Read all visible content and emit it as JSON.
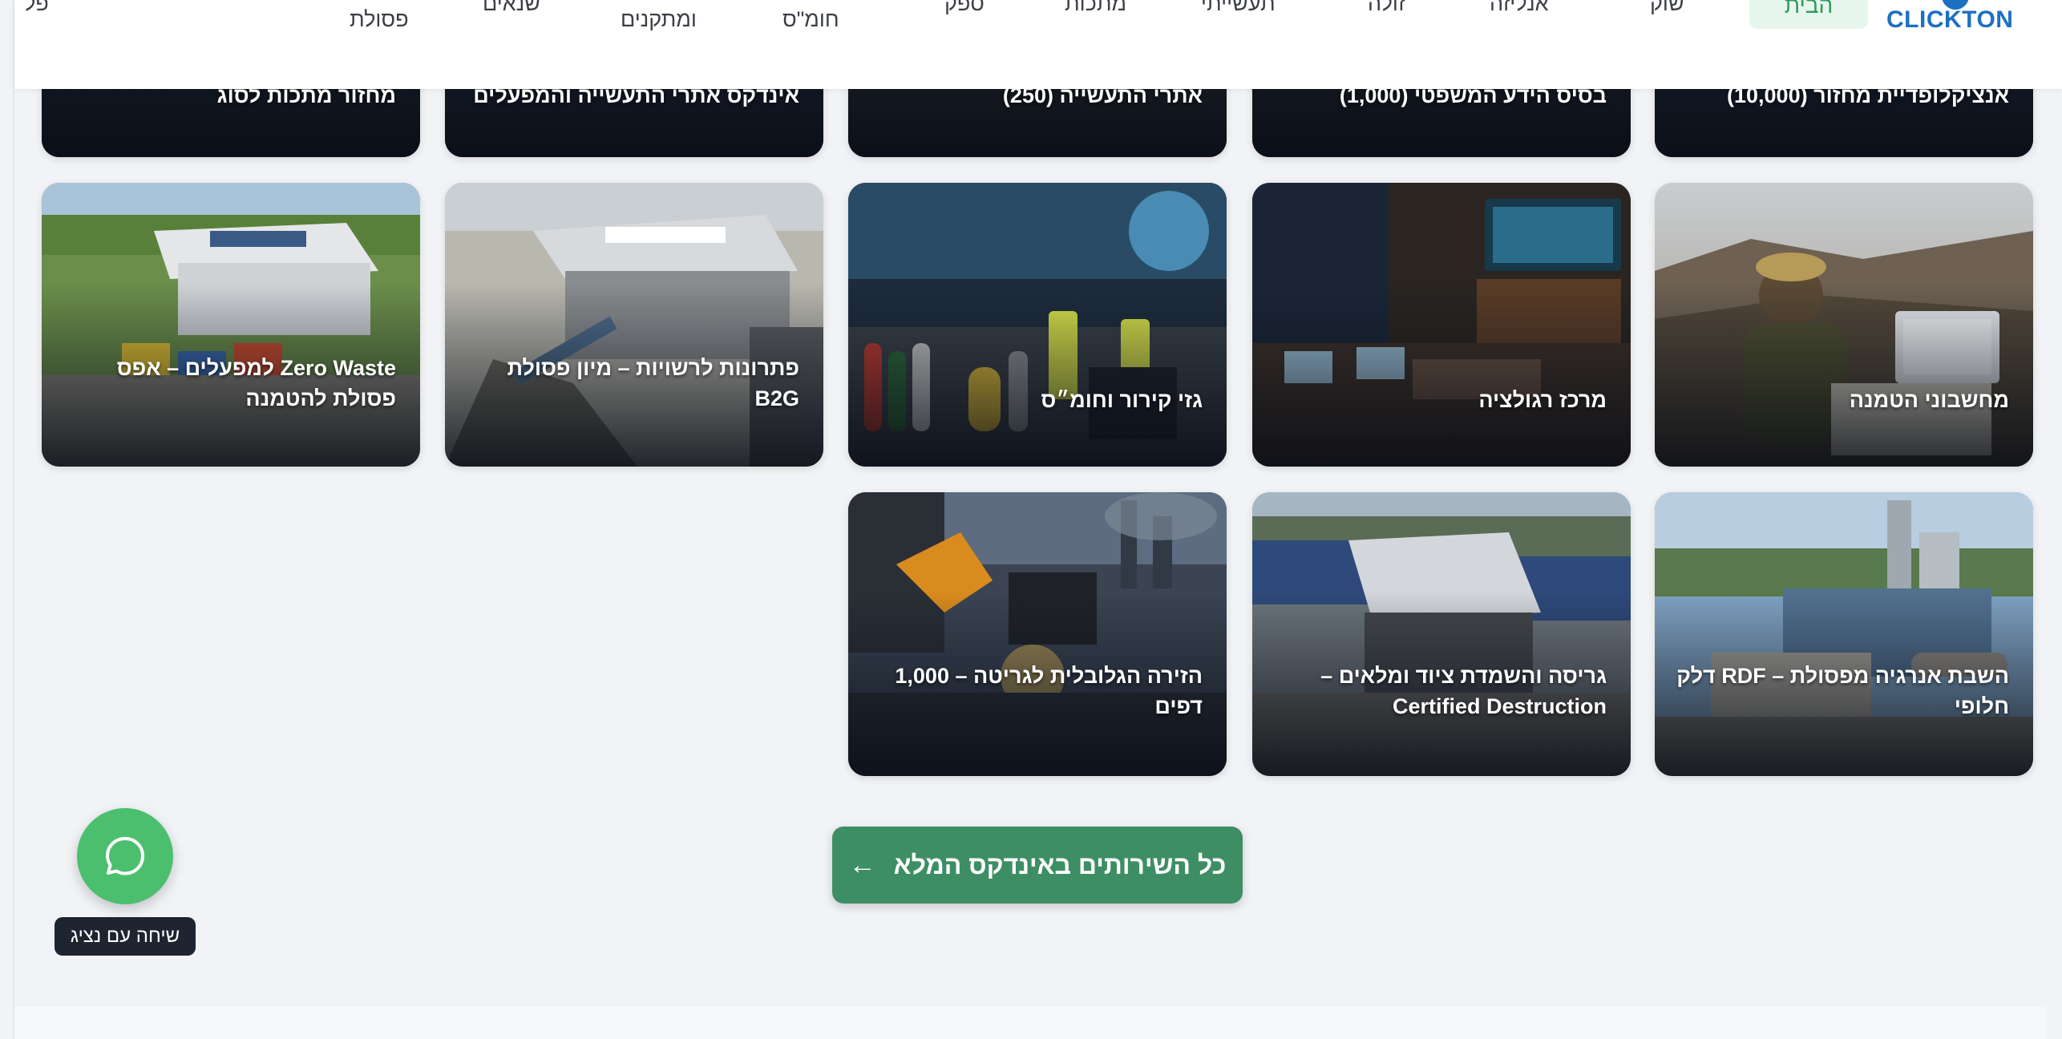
{
  "brand": {
    "logo_text": "CLICKTON"
  },
  "nav": {
    "home": "הבית",
    "items": [
      "שוק",
      "אנליזה",
      "זולה",
      "תעשייתי",
      "מתכות",
      "ספק",
      "חומ\"ס",
      "ומתקנים",
      "שנאים",
      "פסולת",
      "פל"
    ]
  },
  "cards_top_row": [
    "אנציקלופדיית מחזור (10,000)",
    "בסיס הידע המשפטי (1,000)",
    "אתרי התעשייה (250)",
    "אינדקס אתרי התעשייה והמפעלים",
    "מחזור מתכות לסוג"
  ],
  "cards_row2": [
    "מחשבוני הטמנה",
    "מרכז רגולציה",
    "גזי קירור וחומ״ס",
    "פתרונות לרשויות – מיון פסולת B2G",
    "Zero Waste למפעלים – אפס פסולת להטמנה"
  ],
  "cards_row3": [
    "השבת אנרגיה מפסולת – RDF דלק חלופי",
    "גריסה והשמדת ציוד ומלאים – Certified Destruction",
    "הזירה הגלובלית לגריטה – 1,000 דפים"
  ],
  "cta": {
    "label": "כל השירותים באינדקס המלא",
    "arrow": "←"
  },
  "whatsapp": {
    "label": "שיחה עם נציג"
  },
  "colors": {
    "primary_green": "#3e8e65",
    "whatsapp_green": "#4cbf6e",
    "brand_blue": "#1d6fc2"
  }
}
